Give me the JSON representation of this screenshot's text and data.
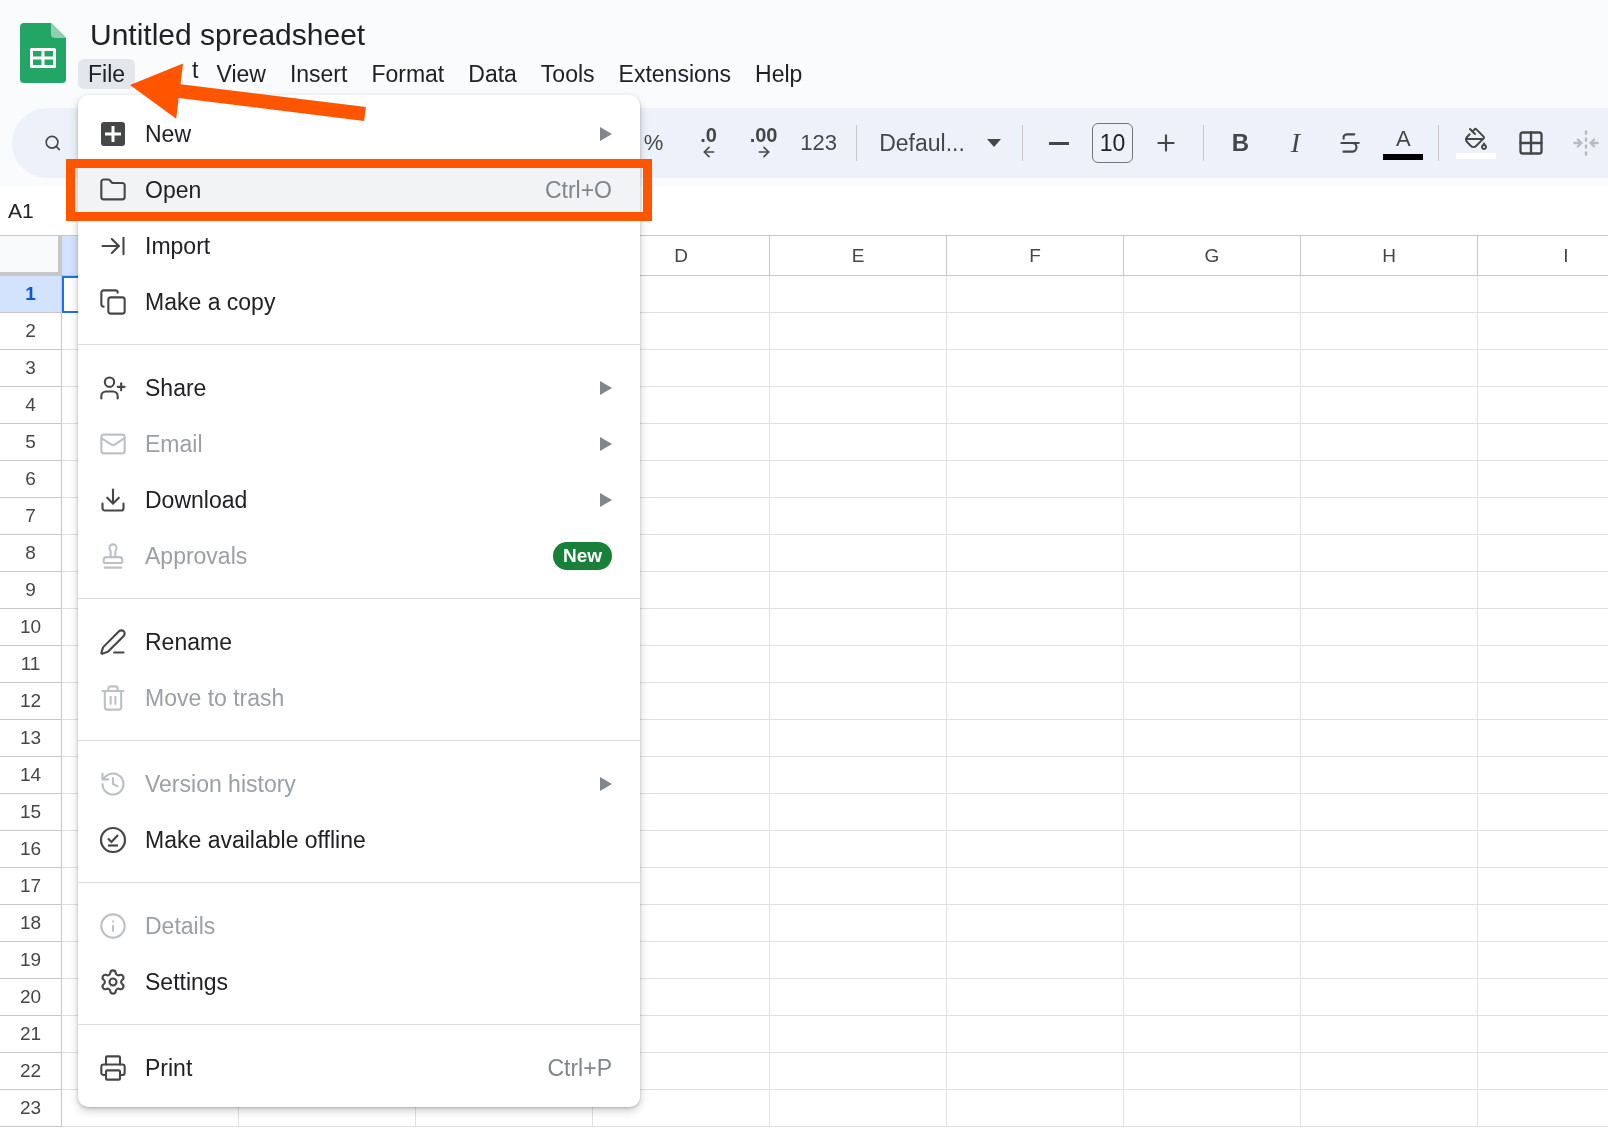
{
  "app": {
    "title": "Untitled spreadsheet"
  },
  "menu_bar": [
    {
      "label": "File",
      "selected": true,
      "pointed": true
    },
    {
      "label": "t",
      "selected": false,
      "pointed": false
    },
    {
      "label": "View",
      "selected": false,
      "pointed": false
    },
    {
      "label": "Insert",
      "selected": false,
      "pointed": false
    },
    {
      "label": "Format",
      "selected": false,
      "pointed": false
    },
    {
      "label": "Data",
      "selected": false,
      "pointed": false
    },
    {
      "label": "Tools",
      "selected": false,
      "pointed": false
    },
    {
      "label": "Extensions",
      "selected": false,
      "pointed": false
    },
    {
      "label": "Help",
      "selected": false,
      "pointed": false
    }
  ],
  "toolbar": [
    {
      "kind": "text",
      "label": "%"
    },
    {
      "kind": "decrease_decimal",
      "label": ".0"
    },
    {
      "kind": "increase_decimal",
      "label": ".00"
    },
    {
      "kind": "text",
      "label": "123"
    },
    {
      "kind": "separator"
    },
    {
      "kind": "dropdown",
      "label": "Defaul..."
    },
    {
      "kind": "separator"
    },
    {
      "kind": "minus"
    },
    {
      "kind": "size",
      "label": "10"
    },
    {
      "kind": "plus"
    },
    {
      "kind": "separator"
    },
    {
      "kind": "bold",
      "label": "B"
    },
    {
      "kind": "italic",
      "label": "I"
    },
    {
      "kind": "strikethrough"
    },
    {
      "kind": "text_color",
      "label": "A"
    },
    {
      "kind": "separator"
    },
    {
      "kind": "fill_color"
    },
    {
      "kind": "borders"
    },
    {
      "kind": "merge",
      "disabled": true
    }
  ],
  "name_box": "A1",
  "columns": [
    "D",
    "E",
    "F",
    "G",
    "H",
    "I"
  ],
  "rows": [
    {
      "label": "1",
      "selected": true
    },
    {
      "label": "2",
      "selected": false
    },
    {
      "label": "3",
      "selected": false
    },
    {
      "label": "4",
      "selected": false
    },
    {
      "label": "5",
      "selected": false
    },
    {
      "label": "6",
      "selected": false
    },
    {
      "label": "7",
      "selected": false
    },
    {
      "label": "8",
      "selected": false
    },
    {
      "label": "9",
      "selected": false
    },
    {
      "label": "10",
      "selected": false
    },
    {
      "label": "11",
      "selected": false
    },
    {
      "label": "12",
      "selected": false
    },
    {
      "label": "13",
      "selected": false
    },
    {
      "label": "14",
      "selected": false
    },
    {
      "label": "15",
      "selected": false
    },
    {
      "label": "16",
      "selected": false
    },
    {
      "label": "17",
      "selected": false
    },
    {
      "label": "18",
      "selected": false
    },
    {
      "label": "19",
      "selected": false
    },
    {
      "label": "20",
      "selected": false
    },
    {
      "label": "21",
      "selected": false
    },
    {
      "label": "22",
      "selected": false
    },
    {
      "label": "23",
      "selected": false
    }
  ],
  "file_menu": [
    [
      {
        "kind": "new",
        "label": "New",
        "submenu": true,
        "disabled": false,
        "selected": false,
        "boxed": false
      },
      {
        "kind": "open",
        "label": "Open",
        "shortcut": "Ctrl+O",
        "submenu": false,
        "disabled": false,
        "selected": true,
        "boxed": true
      },
      {
        "kind": "import",
        "label": "Import",
        "submenu": false,
        "disabled": false,
        "selected": false,
        "boxed": false
      },
      {
        "kind": "copy",
        "label": "Make a copy",
        "submenu": false,
        "disabled": false,
        "selected": false,
        "boxed": false
      }
    ],
    [
      {
        "kind": "share",
        "label": "Share",
        "submenu": true,
        "disabled": false,
        "selected": false,
        "boxed": false
      },
      {
        "kind": "email",
        "label": "Email",
        "submenu": true,
        "disabled": true,
        "selected": false,
        "boxed": false
      },
      {
        "kind": "download",
        "label": "Download",
        "submenu": true,
        "disabled": false,
        "selected": false,
        "boxed": false
      },
      {
        "kind": "approvals",
        "label": "Approvals",
        "badge": "New",
        "submenu": false,
        "disabled": true,
        "selected": false,
        "boxed": false
      }
    ],
    [
      {
        "kind": "rename",
        "label": "Rename",
        "submenu": false,
        "disabled": false,
        "selected": false,
        "boxed": false
      },
      {
        "kind": "trash",
        "label": "Move to trash",
        "submenu": false,
        "disabled": true,
        "selected": false,
        "boxed": false
      }
    ],
    [
      {
        "kind": "history",
        "label": "Version history",
        "submenu": true,
        "disabled": true,
        "selected": false,
        "boxed": false
      },
      {
        "kind": "offline",
        "label": "Make available offline",
        "submenu": false,
        "disabled": false,
        "selected": false,
        "boxed": false
      }
    ],
    [
      {
        "kind": "details",
        "label": "Details",
        "submenu": false,
        "disabled": true,
        "selected": false,
        "boxed": false
      },
      {
        "kind": "settings",
        "label": "Settings",
        "submenu": false,
        "disabled": false,
        "selected": false,
        "boxed": false
      }
    ],
    [
      {
        "kind": "print",
        "label": "Print",
        "shortcut": "Ctrl+P",
        "submenu": false,
        "disabled": false,
        "selected": false,
        "boxed": false
      }
    ]
  ]
}
